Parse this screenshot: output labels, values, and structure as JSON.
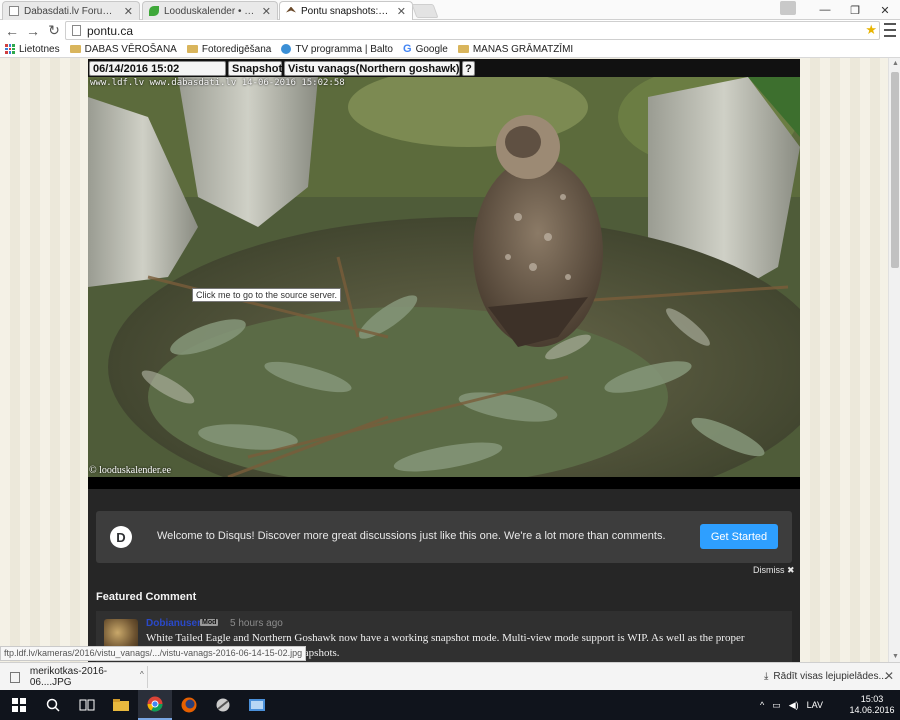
{
  "browser": {
    "tabs": [
      {
        "label": "Dabasdati.lv Forums - Api",
        "icon": "document-icon",
        "active": false
      },
      {
        "label": "Looduskalender • View to",
        "icon": "leaf-icon",
        "active": false
      },
      {
        "label": "Pontu snapshots:vistu_van",
        "icon": "bird-icon",
        "active": true
      }
    ],
    "url": "pontu.ca",
    "bookmarks": [
      {
        "label": "Lietotnes",
        "icon": "apps-icon"
      },
      {
        "label": "DABAS VĒROŠANA",
        "icon": "folder-icon"
      },
      {
        "label": "Fotoredigēšana",
        "icon": "folder-icon"
      },
      {
        "label": "TV programma | Balto",
        "icon": "tv-icon"
      },
      {
        "label": "Google",
        "icon": "google-icon"
      },
      {
        "label": "MANAS GRĀMATZĪMI",
        "icon": "folder-icon"
      }
    ]
  },
  "page": {
    "datetime": "06/14/2016 15:02",
    "snapshots_label": "Snapshots",
    "camera_name": "Vistu vanags(Northern goshawk)",
    "help_label": "?",
    "cam_timestamp": "www.ldf.lv www.dabasdati.lv 14-06-2016 15:02:58",
    "cam_copyright": "© looduskalender.ee",
    "tooltip": "Click me to go to the source server."
  },
  "disqus": {
    "logo": "D",
    "welcome": "Welcome to Disqus! Discover more great discussions just like this one. We're a lot more than comments.",
    "get_started": "Get Started",
    "dismiss": "Dismiss ✖",
    "featured_heading": "Featured Comment",
    "comment": {
      "author": "Dobianuser",
      "badge": "Mod",
      "time": "5 hours ago",
      "text": "White Tailed Eagle and Northern Goshawk now have a working snapshot mode. Multi-view mode support is WIP. As well as the proper",
      "text_line2": "snapshots."
    }
  },
  "status_url": "ftp.ldf.lv/kameras/2016/vistu_vanags/.../vistu-vanags-2016-06-14-15-02.jpg",
  "downloads": {
    "item": "merikotkas-2016-06....JPG",
    "show_all": "Rādīt visas lejupielādes..."
  },
  "taskbar": {
    "language": "LAV",
    "time": "15:03",
    "date": "14.06.2016"
  },
  "colors": {
    "disqus_button": "#2e9fff",
    "panel_bg": "#262626",
    "author_link": "#2a49c9"
  }
}
